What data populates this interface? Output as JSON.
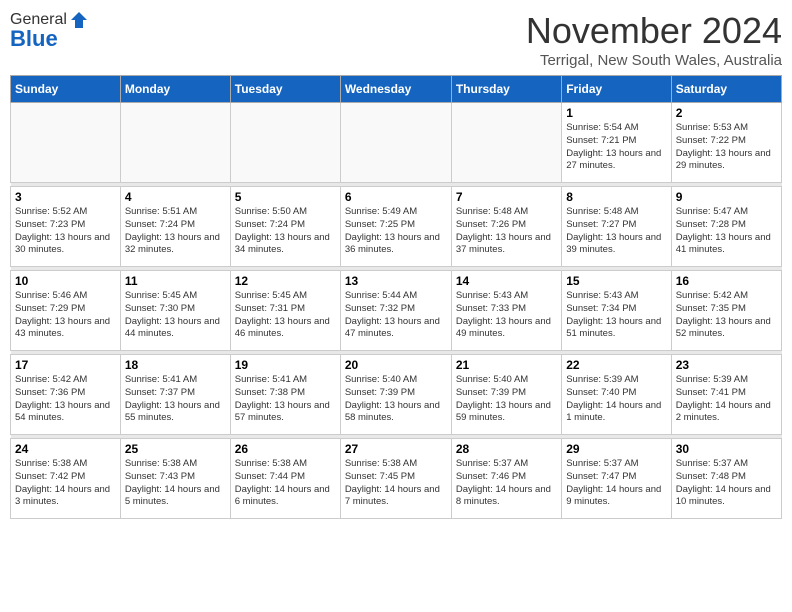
{
  "logo": {
    "general": "General",
    "blue": "Blue"
  },
  "header": {
    "month": "November 2024",
    "location": "Terrigal, New South Wales, Australia"
  },
  "days_of_week": [
    "Sunday",
    "Monday",
    "Tuesday",
    "Wednesday",
    "Thursday",
    "Friday",
    "Saturday"
  ],
  "weeks": [
    [
      {
        "day": "",
        "info": ""
      },
      {
        "day": "",
        "info": ""
      },
      {
        "day": "",
        "info": ""
      },
      {
        "day": "",
        "info": ""
      },
      {
        "day": "",
        "info": ""
      },
      {
        "day": "1",
        "info": "Sunrise: 5:54 AM\nSunset: 7:21 PM\nDaylight: 13 hours and 27 minutes."
      },
      {
        "day": "2",
        "info": "Sunrise: 5:53 AM\nSunset: 7:22 PM\nDaylight: 13 hours and 29 minutes."
      }
    ],
    [
      {
        "day": "3",
        "info": "Sunrise: 5:52 AM\nSunset: 7:23 PM\nDaylight: 13 hours and 30 minutes."
      },
      {
        "day": "4",
        "info": "Sunrise: 5:51 AM\nSunset: 7:24 PM\nDaylight: 13 hours and 32 minutes."
      },
      {
        "day": "5",
        "info": "Sunrise: 5:50 AM\nSunset: 7:24 PM\nDaylight: 13 hours and 34 minutes."
      },
      {
        "day": "6",
        "info": "Sunrise: 5:49 AM\nSunset: 7:25 PM\nDaylight: 13 hours and 36 minutes."
      },
      {
        "day": "7",
        "info": "Sunrise: 5:48 AM\nSunset: 7:26 PM\nDaylight: 13 hours and 37 minutes."
      },
      {
        "day": "8",
        "info": "Sunrise: 5:48 AM\nSunset: 7:27 PM\nDaylight: 13 hours and 39 minutes."
      },
      {
        "day": "9",
        "info": "Sunrise: 5:47 AM\nSunset: 7:28 PM\nDaylight: 13 hours and 41 minutes."
      }
    ],
    [
      {
        "day": "10",
        "info": "Sunrise: 5:46 AM\nSunset: 7:29 PM\nDaylight: 13 hours and 43 minutes."
      },
      {
        "day": "11",
        "info": "Sunrise: 5:45 AM\nSunset: 7:30 PM\nDaylight: 13 hours and 44 minutes."
      },
      {
        "day": "12",
        "info": "Sunrise: 5:45 AM\nSunset: 7:31 PM\nDaylight: 13 hours and 46 minutes."
      },
      {
        "day": "13",
        "info": "Sunrise: 5:44 AM\nSunset: 7:32 PM\nDaylight: 13 hours and 47 minutes."
      },
      {
        "day": "14",
        "info": "Sunrise: 5:43 AM\nSunset: 7:33 PM\nDaylight: 13 hours and 49 minutes."
      },
      {
        "day": "15",
        "info": "Sunrise: 5:43 AM\nSunset: 7:34 PM\nDaylight: 13 hours and 51 minutes."
      },
      {
        "day": "16",
        "info": "Sunrise: 5:42 AM\nSunset: 7:35 PM\nDaylight: 13 hours and 52 minutes."
      }
    ],
    [
      {
        "day": "17",
        "info": "Sunrise: 5:42 AM\nSunset: 7:36 PM\nDaylight: 13 hours and 54 minutes."
      },
      {
        "day": "18",
        "info": "Sunrise: 5:41 AM\nSunset: 7:37 PM\nDaylight: 13 hours and 55 minutes."
      },
      {
        "day": "19",
        "info": "Sunrise: 5:41 AM\nSunset: 7:38 PM\nDaylight: 13 hours and 57 minutes."
      },
      {
        "day": "20",
        "info": "Sunrise: 5:40 AM\nSunset: 7:39 PM\nDaylight: 13 hours and 58 minutes."
      },
      {
        "day": "21",
        "info": "Sunrise: 5:40 AM\nSunset: 7:39 PM\nDaylight: 13 hours and 59 minutes."
      },
      {
        "day": "22",
        "info": "Sunrise: 5:39 AM\nSunset: 7:40 PM\nDaylight: 14 hours and 1 minute."
      },
      {
        "day": "23",
        "info": "Sunrise: 5:39 AM\nSunset: 7:41 PM\nDaylight: 14 hours and 2 minutes."
      }
    ],
    [
      {
        "day": "24",
        "info": "Sunrise: 5:38 AM\nSunset: 7:42 PM\nDaylight: 14 hours and 3 minutes."
      },
      {
        "day": "25",
        "info": "Sunrise: 5:38 AM\nSunset: 7:43 PM\nDaylight: 14 hours and 5 minutes."
      },
      {
        "day": "26",
        "info": "Sunrise: 5:38 AM\nSunset: 7:44 PM\nDaylight: 14 hours and 6 minutes."
      },
      {
        "day": "27",
        "info": "Sunrise: 5:38 AM\nSunset: 7:45 PM\nDaylight: 14 hours and 7 minutes."
      },
      {
        "day": "28",
        "info": "Sunrise: 5:37 AM\nSunset: 7:46 PM\nDaylight: 14 hours and 8 minutes."
      },
      {
        "day": "29",
        "info": "Sunrise: 5:37 AM\nSunset: 7:47 PM\nDaylight: 14 hours and 9 minutes."
      },
      {
        "day": "30",
        "info": "Sunrise: 5:37 AM\nSunset: 7:48 PM\nDaylight: 14 hours and 10 minutes."
      }
    ]
  ]
}
